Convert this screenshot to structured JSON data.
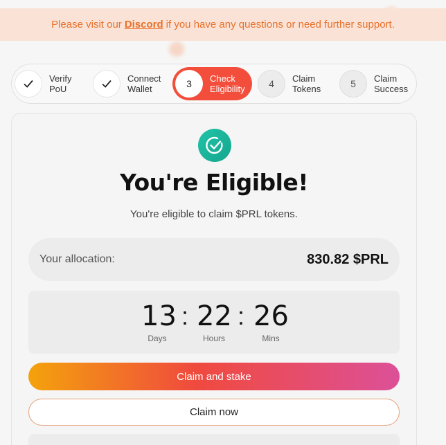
{
  "banner": {
    "prefix": "Please visit our",
    "link": "Discord",
    "suffix": "if you have any questions or need further support."
  },
  "steps": [
    {
      "num": "",
      "line1": "Verify",
      "line2": "PoU",
      "state": "done"
    },
    {
      "num": "",
      "line1": "Connect",
      "line2": "Wallet",
      "state": "done"
    },
    {
      "num": "3",
      "line1": "Check",
      "line2": "Eligibility",
      "state": "active"
    },
    {
      "num": "4",
      "line1": "Claim",
      "line2": "Tokens",
      "state": "todo"
    },
    {
      "num": "5",
      "line1": "Claim",
      "line2": "Success",
      "state": "todo"
    }
  ],
  "card": {
    "title": "You're Eligible!",
    "subtitle": "You're eligible to claim $PRL tokens.",
    "allocation_label": "Your allocation:",
    "allocation_value": "830.82 $PRL"
  },
  "timer": {
    "days": "13",
    "hours": "22",
    "mins": "26",
    "sep": ":",
    "days_label": "Days",
    "hours_label": "Hours",
    "mins_label": "Mins"
  },
  "buttons": {
    "claim_stake": "Claim and stake",
    "claim_now": "Claim now"
  },
  "colors": {
    "accent": "#f24e3b",
    "banner_text": "#e8702a",
    "badge": "#1fb89f"
  }
}
